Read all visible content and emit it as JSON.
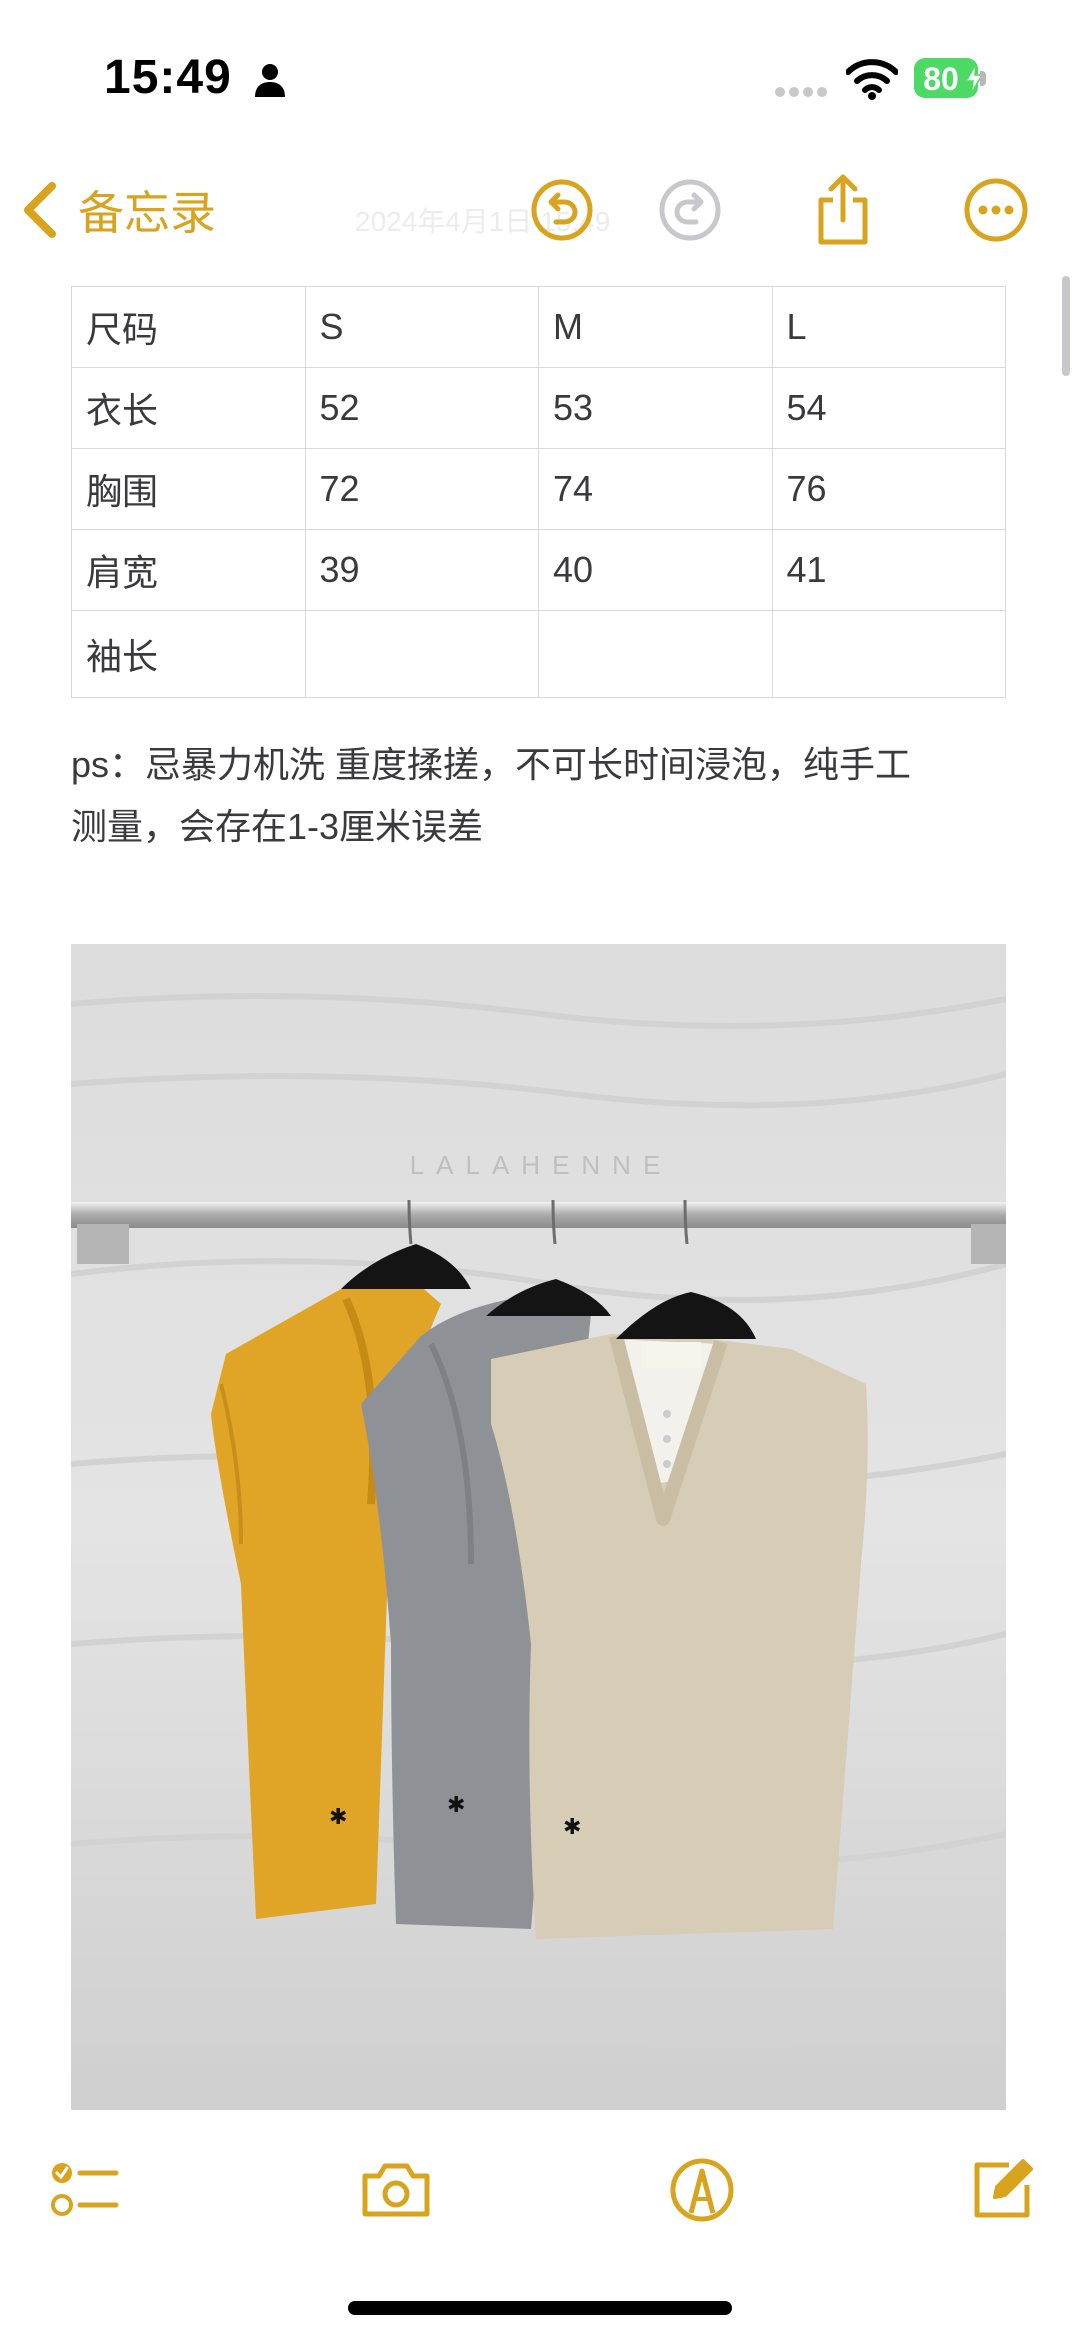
{
  "status_bar": {
    "time": "15:49",
    "battery_percent": "80",
    "icons": [
      "person-icon",
      "signal-icon",
      "wifi-icon",
      "battery-icon",
      "charging-bolt-icon"
    ]
  },
  "nav": {
    "back_label": "备忘录",
    "faded_title": "2024年4月1日 15:49",
    "icons": [
      "chevron-left-icon",
      "undo-icon",
      "redo-icon",
      "share-icon",
      "more-icon"
    ],
    "accent_color": "#d8a31d"
  },
  "size_table": {
    "rows": [
      [
        "尺码",
        "S",
        "M",
        "L"
      ],
      [
        "衣长",
        "52",
        "53",
        "54"
      ],
      [
        "胸围",
        "72",
        "74",
        "76"
      ],
      [
        "肩宽",
        "39",
        "40",
        "41"
      ],
      [
        "袖长",
        "",
        "",
        ""
      ]
    ]
  },
  "note": {
    "text_line1": "ps：忌暴力机洗 重度揉搓，不可长时间浸泡，纯手工",
    "text_line2": "测量，会存在1-3厘米误差"
  },
  "photo": {
    "watermark": "LALAHENNE"
  },
  "toolbar": {
    "icons": [
      "checklist-icon",
      "camera-icon",
      "markup-icon",
      "compose-icon"
    ]
  }
}
